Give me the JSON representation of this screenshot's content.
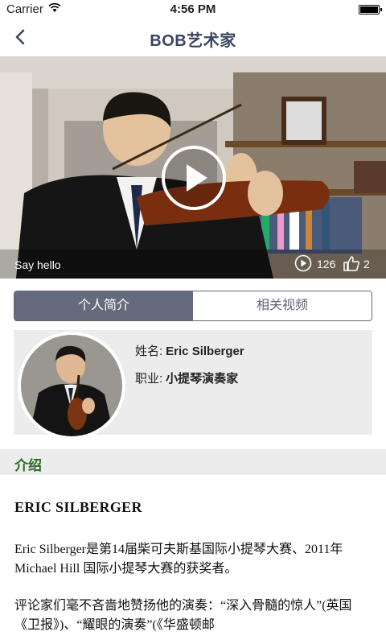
{
  "status_bar": {
    "carrier": "Carrier",
    "time": "4:56 PM"
  },
  "nav": {
    "title": "BOB艺术家"
  },
  "video": {
    "caption": "Say hello",
    "views": "126",
    "likes": "2"
  },
  "tabs": [
    {
      "label": "个人简介"
    },
    {
      "label": "相关视频"
    }
  ],
  "profile": {
    "name_label": "姓名:",
    "name": "Eric Silberger",
    "job_label": "职业:",
    "job": "小提琴演奏家"
  },
  "section": {
    "title": "介绍"
  },
  "article": {
    "heading": "ERIC SILBERGER",
    "paragraphs": [
      "Eric Silberger是第14届柴可夫斯基国际小提琴大赛、2011年 Michael  Hill 国际小提琴大赛的获奖者。",
      "评论家们毫不吝啬地赞扬他的演奏：“深入骨髓的惊人”(英国《卫报》)、“耀眼的演奏”(《华盛顿邮"
    ]
  }
}
